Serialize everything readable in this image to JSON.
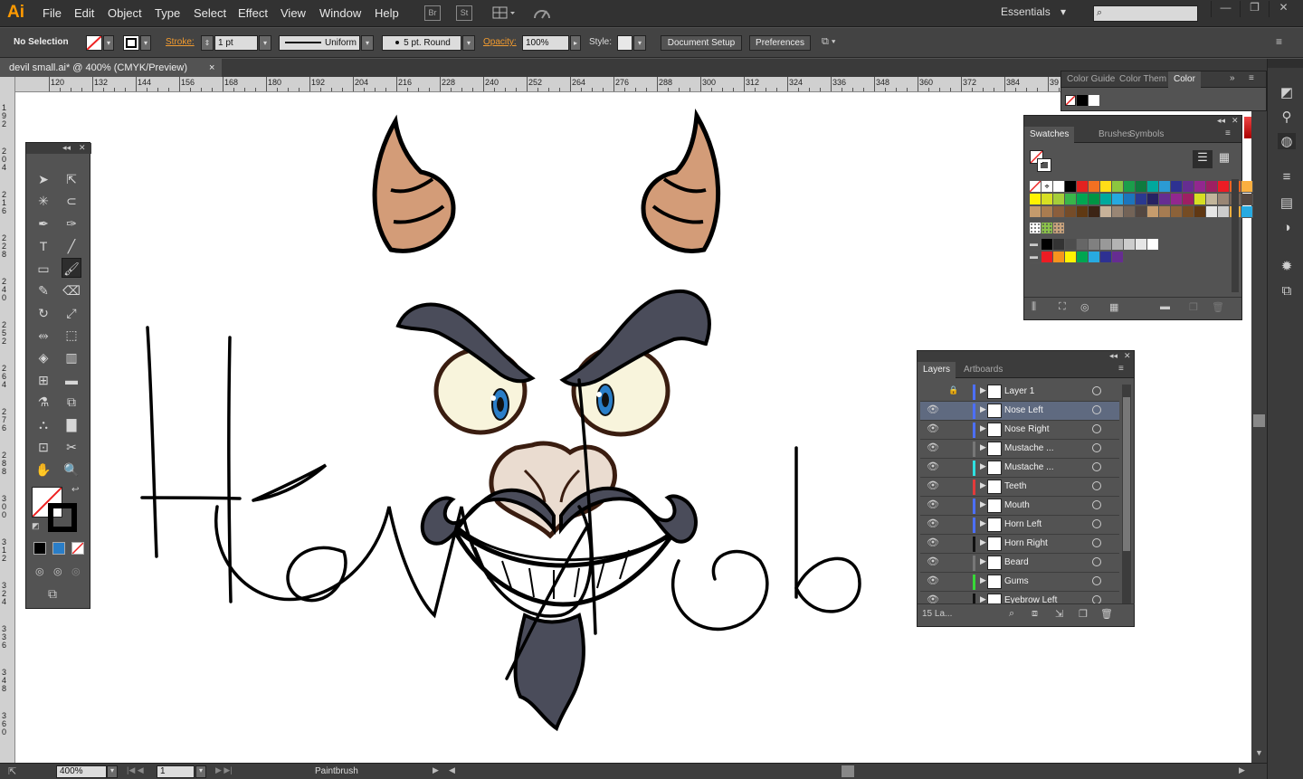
{
  "app": {
    "logo": "Ai"
  },
  "menu": [
    "File",
    "Edit",
    "Object",
    "Type",
    "Select",
    "Effect",
    "View",
    "Window",
    "Help"
  ],
  "menu_icons": {
    "bridge": "Br",
    "stock": "St",
    "arrange": "arrange-documents-icon",
    "gpu": "gpu-performance-icon"
  },
  "workspace": {
    "label": "Essentials",
    "arrow": "▾"
  },
  "window_buttons": {
    "minimize": "—",
    "restore": "❐",
    "close": "✕"
  },
  "control": {
    "selection": "No Selection",
    "stroke_label": "Stroke:",
    "stroke_weight": "1 pt",
    "profile": "Uniform",
    "brush": "5 pt. Round",
    "opacity_label": "Opacity:",
    "opacity": "100%",
    "style_label": "Style:",
    "doc_setup": "Document Setup",
    "preferences": "Preferences"
  },
  "document": {
    "tab": "devil small.ai* @ 400% (CMYK/Preview)",
    "close": "×"
  },
  "ruler_labels": [
    "120",
    "132",
    "144",
    "156",
    "168",
    "180",
    "192",
    "204",
    "216",
    "228",
    "240",
    "252",
    "264",
    "276",
    "288",
    "300",
    "312",
    "324",
    "336",
    "348",
    "360",
    "372",
    "384",
    "39"
  ],
  "vruler_labels": [
    "192",
    "204",
    "216",
    "228",
    "240",
    "252",
    "264",
    "276",
    "288",
    "300",
    "312",
    "324",
    "336",
    "348",
    "360"
  ],
  "color_panel": {
    "tabs": [
      "Color Guide",
      "Color Them",
      "Color"
    ]
  },
  "swatches_panel": {
    "tabs": [
      "Swatches",
      "Brushes",
      "Symbols"
    ]
  },
  "layers_panel": {
    "tabs": [
      "Layers",
      "Artboards"
    ],
    "rows": [
      {
        "name": "Layer 1",
        "color": "#4c6fff",
        "locked": true,
        "visible": false
      },
      {
        "name": "Nose Left",
        "color": "#4c6fff",
        "visible": true,
        "selected": true
      },
      {
        "name": "Nose Right",
        "color": "#4c6fff",
        "visible": true
      },
      {
        "name": "Mustache ...",
        "color": "#777777",
        "visible": true
      },
      {
        "name": "Mustache ...",
        "color": "#2fe0e0",
        "visible": true
      },
      {
        "name": "Teeth",
        "color": "#e23b3b",
        "visible": true
      },
      {
        "name": "Mouth",
        "color": "#4c6fff",
        "visible": true
      },
      {
        "name": "Horn Left",
        "color": "#4c6fff",
        "visible": true
      },
      {
        "name": "Horn Right",
        "color": "#111111",
        "visible": true
      },
      {
        "name": "Beard",
        "color": "#777777",
        "visible": true
      },
      {
        "name": "Gums",
        "color": "#38d838",
        "visible": true
      },
      {
        "name": "Eyebrow Left",
        "color": "#111111",
        "visible": true
      }
    ],
    "count": "15 La..."
  },
  "status": {
    "zoom": "400%",
    "artboard": "1",
    "tool": "Paintbrush"
  },
  "colors": {
    "accent": "#ff9a00",
    "bg": "#535353",
    "canvas": "#ffffff",
    "horn": "#d39c78",
    "face_dark": "#4a4c5a"
  }
}
